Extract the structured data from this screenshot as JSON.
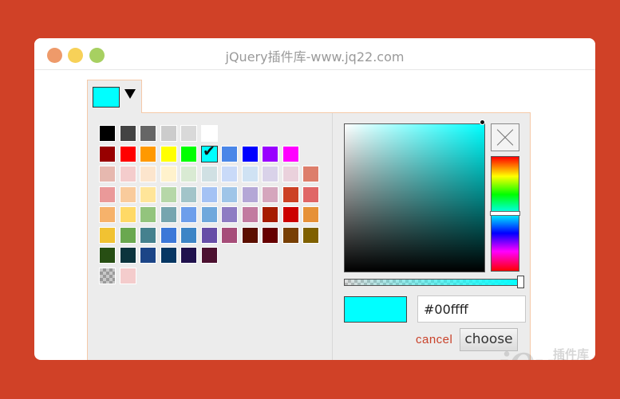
{
  "window": {
    "title": "jQuery插件库-www.jq22.com",
    "controls": [
      {
        "name": "close",
        "color": "#ee9a6a"
      },
      {
        "name": "minimize",
        "color": "#f7d158"
      },
      {
        "name": "maximize",
        "color": "#a7d061"
      }
    ]
  },
  "picker": {
    "selected_color": "#00ffff",
    "trigger_icon": "dropdown-arrow-icon",
    "palette_rows": [
      [
        "#000000",
        "#434343",
        "#666666",
        "#cccccc",
        "#d9d9d9",
        "#ffffff"
      ],
      [
        "#980000",
        "#ff0000",
        "#ff9900",
        "#ffff00",
        "#00ff00",
        "#00ffff",
        "#4a86e8",
        "#0000ff",
        "#9900ff",
        "#ff00ff"
      ],
      [
        "#e6b8af",
        "#f4cccc",
        "#fce5cd",
        "#fff2cc",
        "#d9ead3",
        "#d0e0e3",
        "#c9daf8",
        "#cfe2f3",
        "#d9d2e9",
        "#ead1dc",
        "#dd7e6b"
      ],
      [
        "#ea9999",
        "#f9cb9c",
        "#ffe599",
        "#b6d7a8",
        "#a2c4c9",
        "#a4c2f4",
        "#9fc5e8",
        "#b4a7d6",
        "#d5a6bd",
        "#cc4125",
        "#e06666"
      ],
      [
        "#f6b26b",
        "#ffd966",
        "#93c47d",
        "#76a5af",
        "#6d9eeb",
        "#6fa8dc",
        "#8e7cc3",
        "#c27ba0",
        "#a61c00",
        "#cc0000",
        "#e69138"
      ],
      [
        "#f1c232",
        "#6aa84f",
        "#45818e",
        "#3c78d8",
        "#3d85c6",
        "#674ea7",
        "#a64d79",
        "#5b0f00",
        "#660000",
        "#783f04",
        "#7f6000"
      ],
      [
        "#274e13",
        "#0c343d",
        "#1c4587",
        "#073763",
        "#20124d",
        "#4c1130"
      ],
      [
        "transparent",
        "#f4cccc"
      ]
    ],
    "selected_swatch_row": 1,
    "selected_swatch_index": 5,
    "hue_level": 0.5,
    "alpha_level": 1.0,
    "hex_value": "#00ffff",
    "cancel_label": "cancel",
    "choose_label": "choose",
    "clear_icon": "clear-x-icon"
  },
  "watermark": {
    "text": "jQuery",
    "subtext": "插件库"
  }
}
